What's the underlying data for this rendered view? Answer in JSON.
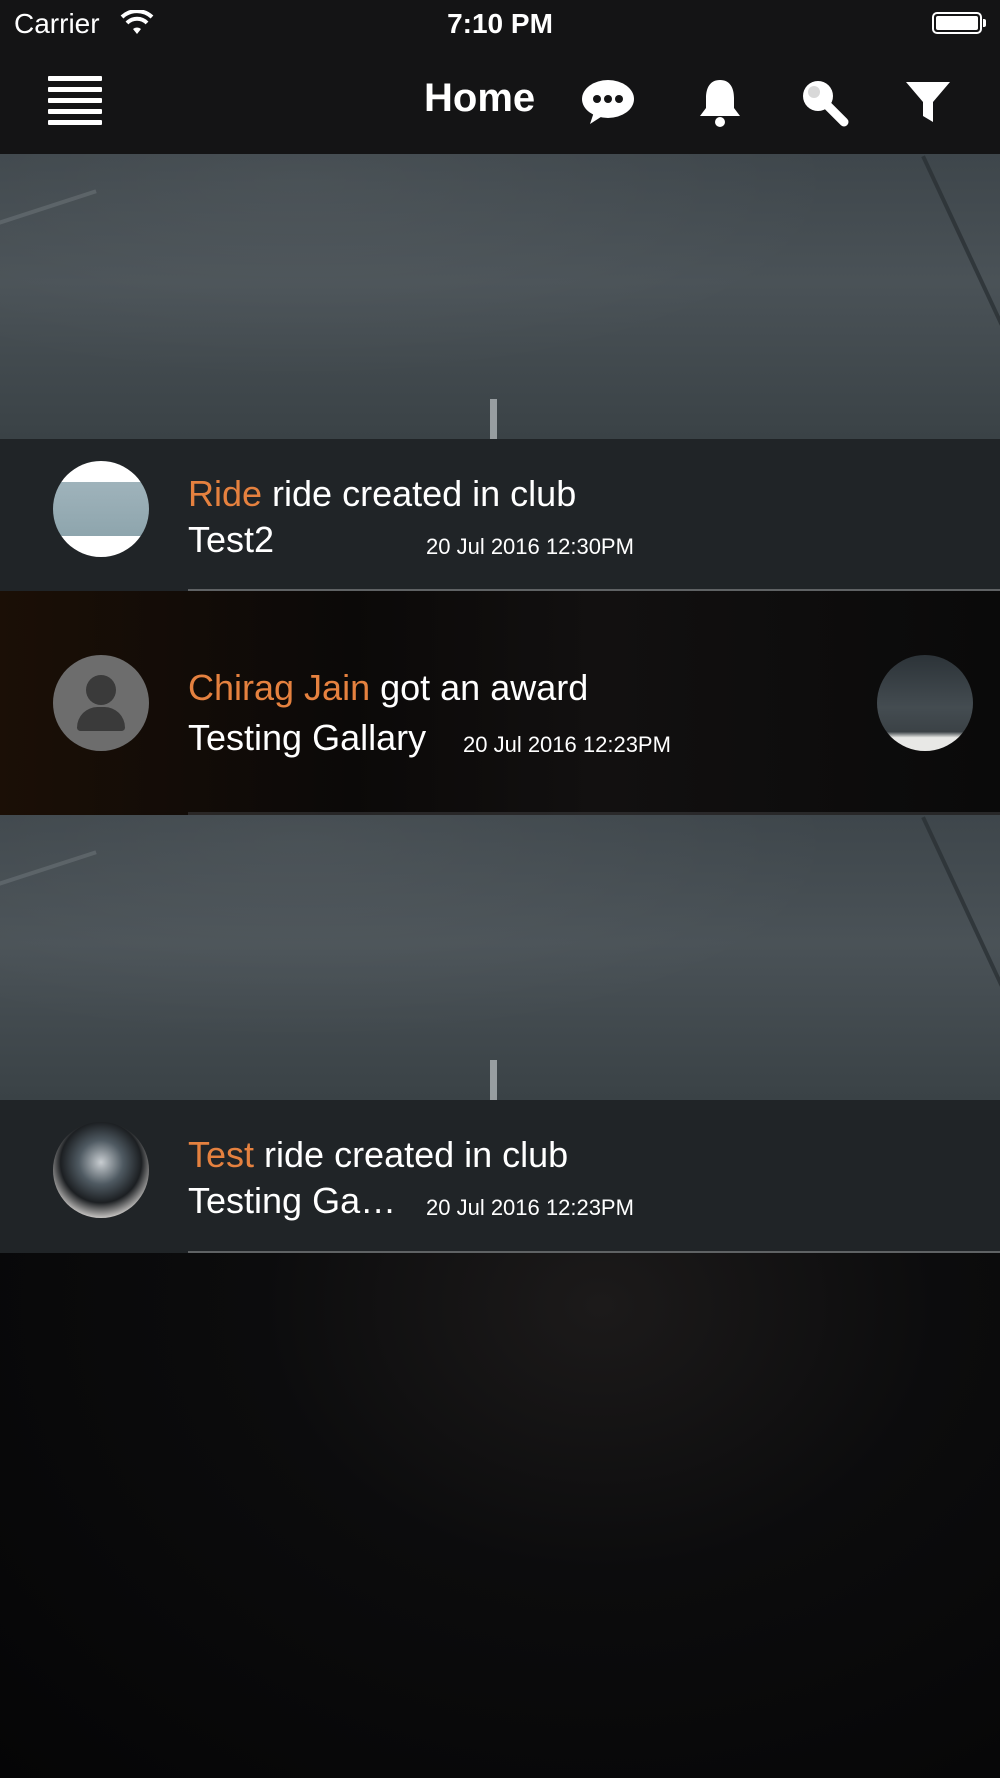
{
  "status_bar": {
    "carrier": "Carrier",
    "time": "7:10 PM"
  },
  "nav": {
    "title": "Home",
    "icons": [
      "menu-icon",
      "chat-icon",
      "bell-icon",
      "search-icon",
      "filter-icon"
    ]
  },
  "feed": [
    {
      "actor": "Ride",
      "action": " ride created in club",
      "detail": "Test2",
      "timestamp": "20 Jul 2016 12:30PM"
    },
    {
      "actor": "Chirag Jain",
      "action": " got an award",
      "detail": "Testing Gallary",
      "timestamp": "20 Jul 2016 12:23PM"
    },
    {
      "actor": "Test",
      "action": " ride created in club",
      "detail": "Testing Ga…",
      "timestamp": "20 Jul 2016 12:23PM"
    }
  ],
  "colors": {
    "accent": "#e5813f",
    "bar": "#141415"
  }
}
